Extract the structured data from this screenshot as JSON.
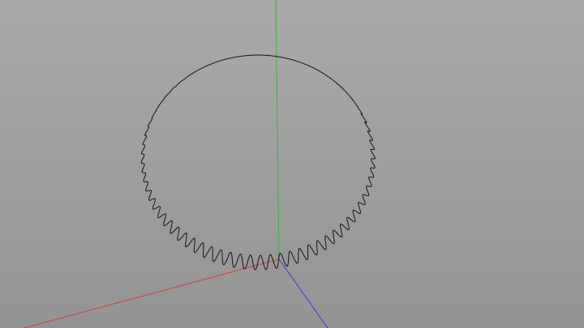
{
  "viewport": {
    "background_top": "#a9a9a9",
    "background_bottom": "#949494"
  },
  "axes": {
    "x_color": "#d04040",
    "y_color": "#3cb43c",
    "z_color": "#3c3cd2"
  },
  "curve": {
    "color": "#141414"
  }
}
